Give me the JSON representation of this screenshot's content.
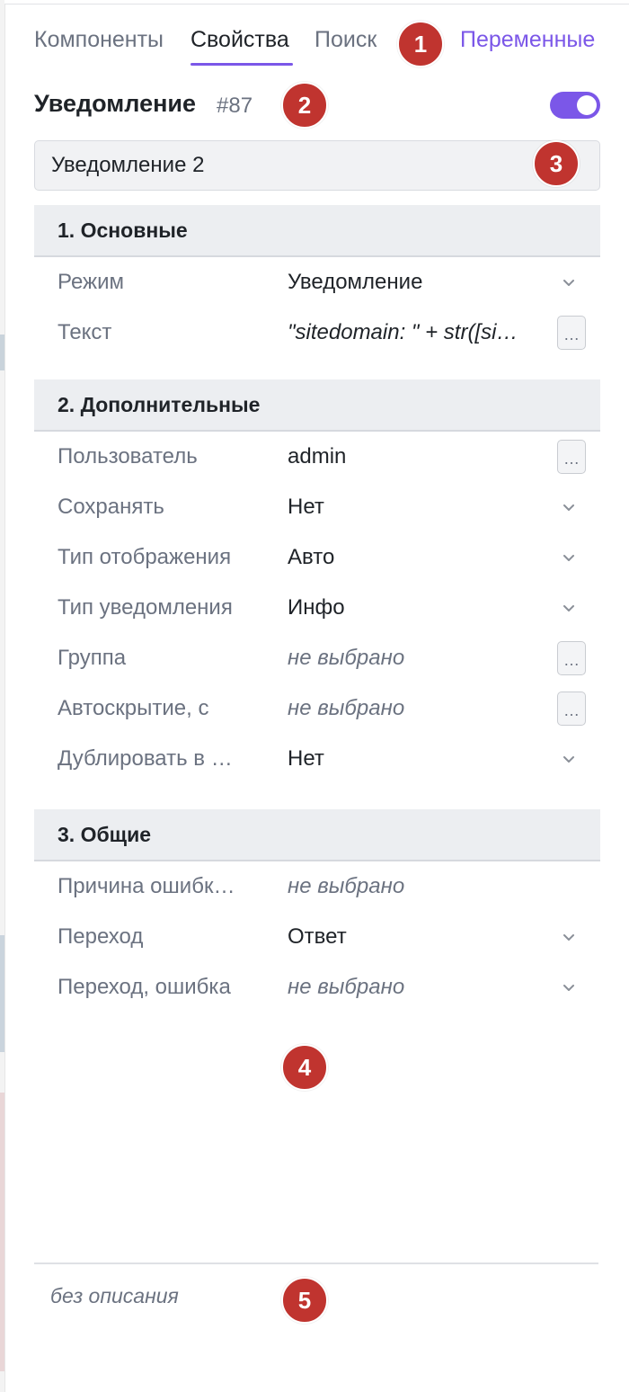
{
  "tabs": [
    {
      "label": "Компоненты"
    },
    {
      "label": "Свойства"
    },
    {
      "label": "Поиск"
    },
    {
      "label": "Переменные"
    }
  ],
  "active_tab": "Свойства",
  "accent_color": "#7b57e8",
  "marker_color": "#c0342f",
  "component": {
    "title": "Уведомление",
    "id": "#87",
    "enabled": true,
    "name": "Уведомление 2"
  },
  "sections": [
    {
      "title": "1. Основные",
      "rows": [
        {
          "label": "Режим",
          "value": "Уведомление",
          "control": "chevron-down-icon"
        },
        {
          "label": "Текст",
          "value": "\"sitedomain: \" + str([si…",
          "control": "more-button"
        }
      ]
    },
    {
      "title": "2. Дополнительные",
      "rows": [
        {
          "label": "Пользователь",
          "value": "admin",
          "control": "more-button"
        },
        {
          "label": "Сохранять",
          "value": "Нет",
          "control": "chevron-down-icon"
        },
        {
          "label": "Тип отображения",
          "value": "Авто",
          "control": "chevron-down-icon"
        },
        {
          "label": "Тип уведомления",
          "value": "Инфо",
          "control": "chevron-down-icon"
        },
        {
          "label": "Группа",
          "value": "не выбрано",
          "control": "more-button"
        },
        {
          "label": "Автоскрытие, с",
          "value": "не выбрано",
          "control": "more-button"
        },
        {
          "label": "Дублировать в …",
          "value": "Нет",
          "control": "chevron-down-icon"
        }
      ]
    },
    {
      "title": "3. Общие",
      "rows": [
        {
          "label": "Причина ошибк…",
          "value": "не выбрано"
        },
        {
          "label": "Переход",
          "value": "Ответ",
          "control": "chevron-down-icon"
        },
        {
          "label": "Переход, ошибка",
          "value": "не выбрано",
          "control": "chevron-down-icon"
        }
      ]
    }
  ],
  "more_button_label": "…",
  "description": "без описания",
  "markers": [
    "1",
    "2",
    "3",
    "4",
    "5"
  ]
}
